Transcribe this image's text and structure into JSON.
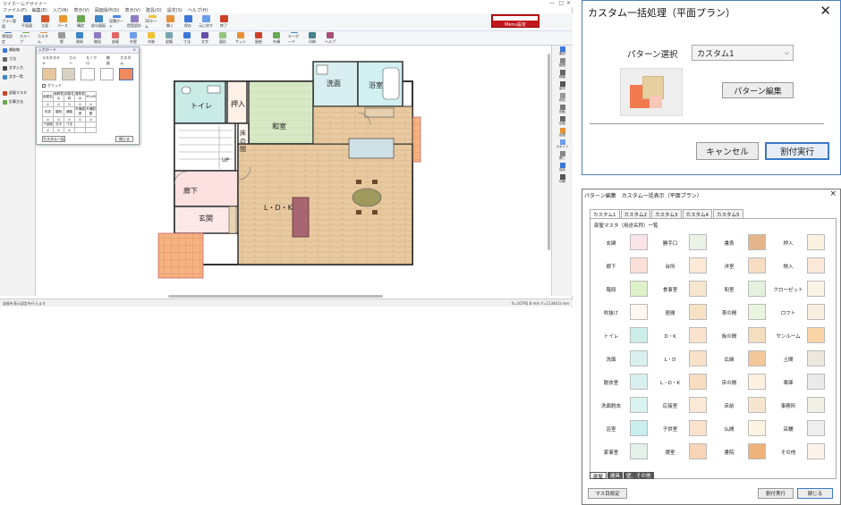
{
  "app": {
    "menubar": [
      "ファイル(F)",
      "編集(E)",
      "入力(N)",
      "表示(V)",
      "図面操作(D)",
      "表示(V)",
      "建具(O)",
      "設定(S)",
      "ヘルプ(H)"
    ],
    "ribbon_top": [
      {
        "label": "プラン管理",
        "icon": "plan-icon",
        "color": "#3a7bd5"
      },
      {
        "label": "平面図",
        "icon": "floor-icon",
        "color": "#2f64b8"
      },
      {
        "label": "立面",
        "icon": "house-icon",
        "color": "#d7562c"
      },
      {
        "label": "パース",
        "icon": "perspective-icon",
        "color": "#e89a2c"
      },
      {
        "label": "構造",
        "icon": "structure-icon",
        "color": "#6aa84f"
      },
      {
        "label": "部分図面",
        "icon": "partial-icon",
        "color": "#3d85c6"
      },
      {
        "label": "見積ボード",
        "icon": "estimate-icon",
        "color": "#4a86e8"
      },
      {
        "label": "提案設計",
        "icon": "proposal-icon",
        "color": "#8e7cc3"
      },
      {
        "label": "3Dホーム",
        "icon": "home3d-icon",
        "color": "#f1c232"
      },
      {
        "label": "開く",
        "icon": "open-icon",
        "color": "#e69138"
      },
      {
        "label": "保存",
        "icon": "save-icon",
        "color": "#3c78d8"
      },
      {
        "label": "元に戻す",
        "icon": "undo-icon",
        "color": "#6d9eeb"
      },
      {
        "label": "終了",
        "icon": "exit-icon",
        "color": "#cc4125"
      }
    ],
    "ribbon_second": [
      "環境設定",
      "グループ",
      "カスタム",
      "壁",
      "建具",
      "階段",
      "部屋",
      "外壁",
      "内装",
      "設備",
      "寸法",
      "文字",
      "図形",
      "サッシ",
      "屋根",
      "外構",
      "キーボード",
      "印刷",
      "ヘルプ"
    ],
    "menu_button": "Menu設定",
    "left_panel": [
      "補助線",
      "寸法",
      "文字入力",
      "文字一覧",
      "部屋マスタ",
      "計算方法"
    ],
    "right_panel": [
      "選択",
      "範囲",
      "移動",
      "複写",
      "削除",
      "回転",
      "反転",
      "部屋",
      "スポイト",
      "開く",
      "保存",
      "印刷"
    ],
    "status_left": "部屋を表示設定を行えます",
    "status_right": "X=10795.8 mm Y=11340.0 mm"
  },
  "palette": {
    "title": "入力ボード",
    "tabs": [
      "ラスタスキャ",
      "カラー",
      "モノクロ",
      "線画",
      "カスタム"
    ],
    "grid_checkbox": "グリッド",
    "table_headers": [
      "部屋名",
      "面積表示",
      "部屋名称",
      "畳数表示",
      "3D-AR"
    ],
    "table_rows": [
      [
        "吹抜",
        "階段",
        "通路",
        "外構建具",
        "外構配置"
      ],
      [
        "下部屋",
        "文字",
        "寸法",
        "",
        ""
      ]
    ],
    "button_left": "カスタム一括",
    "button_right": "閉じる"
  },
  "floor": {
    "rooms": [
      "トイレ",
      "洗面",
      "浴室",
      "和室",
      "押入",
      "床の間",
      "廊下",
      "玄関",
      "L・D・K",
      "UP"
    ]
  },
  "dialog1": {
    "title": "カスタム一括処理（平面プラン）",
    "pattern_label": "パターン選択",
    "pattern_value": "カスタム1",
    "edit_button": "パターン編集",
    "cancel_button": "キャンセル",
    "exec_button": "割付実行"
  },
  "dialog2": {
    "title": "パターン編集　カスタム一括表示（平面プラン）",
    "tabs": [
      "カスタム1",
      "カスタム2",
      "カスタム3",
      "カスタム4",
      "カスタム5"
    ],
    "subtitle": "部屋マスタ（用途名称）一覧",
    "rooms": [
      [
        "玄関",
        "勝手口",
        "書斎",
        "押入"
      ],
      [
        "廊下",
        "台所",
        "洋室",
        "物入"
      ],
      [
        "階段",
        "食事室",
        "和室",
        "クローゼット"
      ],
      [
        "吹抜け",
        "居間",
        "茶の間",
        "ロフト"
      ],
      [
        "トイレ",
        "D・K",
        "板の間",
        "サンルーム"
      ],
      [
        "洗面",
        "L・D",
        "広縁",
        "土間"
      ],
      [
        "脱衣室",
        "L・D・K",
        "床の間",
        "車庫"
      ],
      [
        "洗面脱衣",
        "応接室",
        "床前",
        "事務所"
      ],
      [
        "浴室",
        "子供室",
        "仏間",
        "店舗"
      ],
      [
        "家事室",
        "寝室",
        "書院",
        "その他"
      ]
    ],
    "bottom_tabs": [
      "部屋",
      "建具",
      "壁、その他"
    ],
    "mask_button": "マス目設定",
    "exec_button": "割付実行",
    "close_button": "閉じる"
  }
}
